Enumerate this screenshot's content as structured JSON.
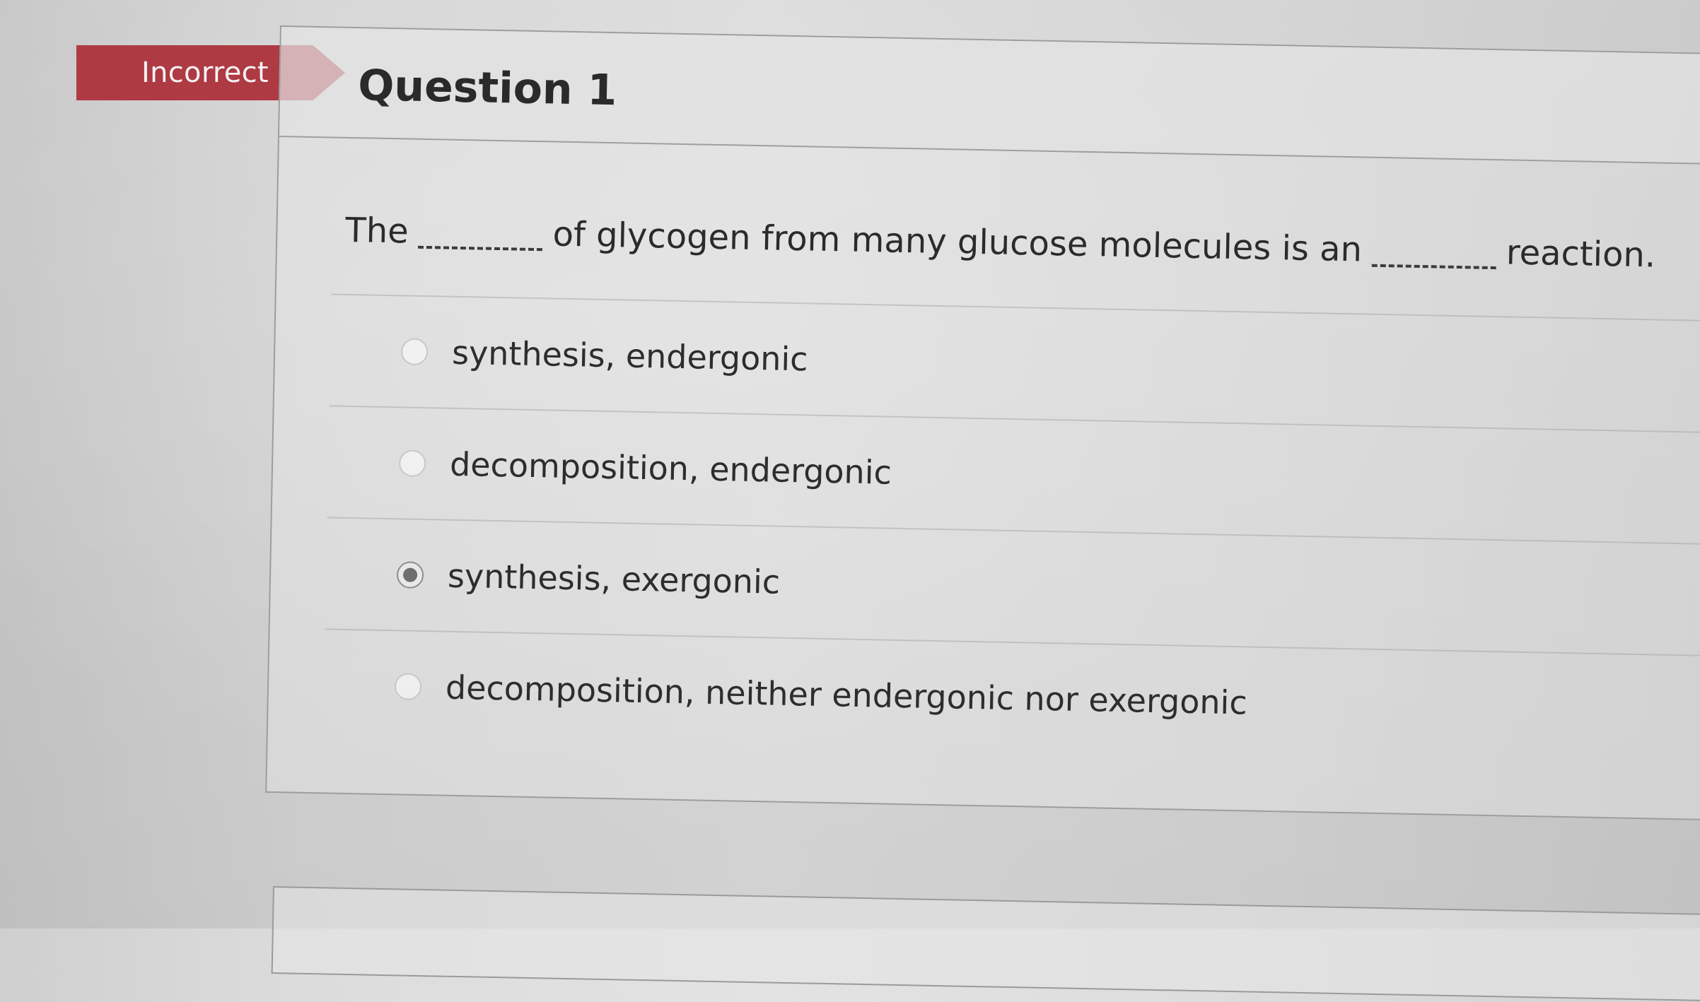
{
  "status": {
    "label": "Incorrect",
    "color": "#ae3a44"
  },
  "question": {
    "title": "Question 1",
    "prompt": {
      "part1": "The",
      "part2": "of glycogen from many glucose molecules is an",
      "part3": "reaction."
    },
    "options": [
      {
        "label": "synthesis, endergonic",
        "selected": false
      },
      {
        "label": "decomposition, endergonic",
        "selected": false
      },
      {
        "label": "synthesis, exergonic",
        "selected": true
      },
      {
        "label": "decomposition, neither endergonic nor exergonic",
        "selected": false
      }
    ]
  }
}
